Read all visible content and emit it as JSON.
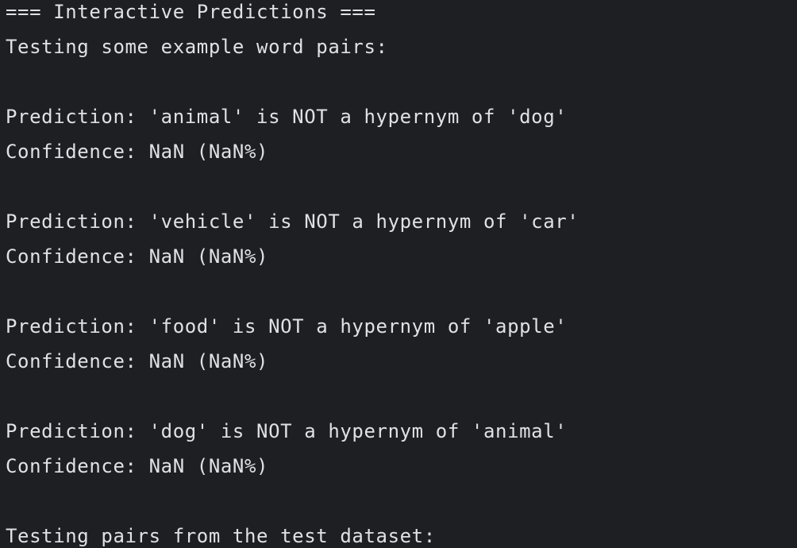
{
  "console": {
    "lines": [
      "=== Interactive Predictions ===",
      "Testing some example word pairs:",
      "",
      "Prediction: 'animal' is NOT a hypernym of 'dog'",
      "Confidence: NaN (NaN%)",
      "",
      "Prediction: 'vehicle' is NOT a hypernym of 'car'",
      "Confidence: NaN (NaN%)",
      "",
      "Prediction: 'food' is NOT a hypernym of 'apple'",
      "Confidence: NaN (NaN%)",
      "",
      "Prediction: 'dog' is NOT a hypernym of 'animal'",
      "Confidence: NaN (NaN%)",
      "",
      "Testing pairs from the test dataset:"
    ]
  }
}
